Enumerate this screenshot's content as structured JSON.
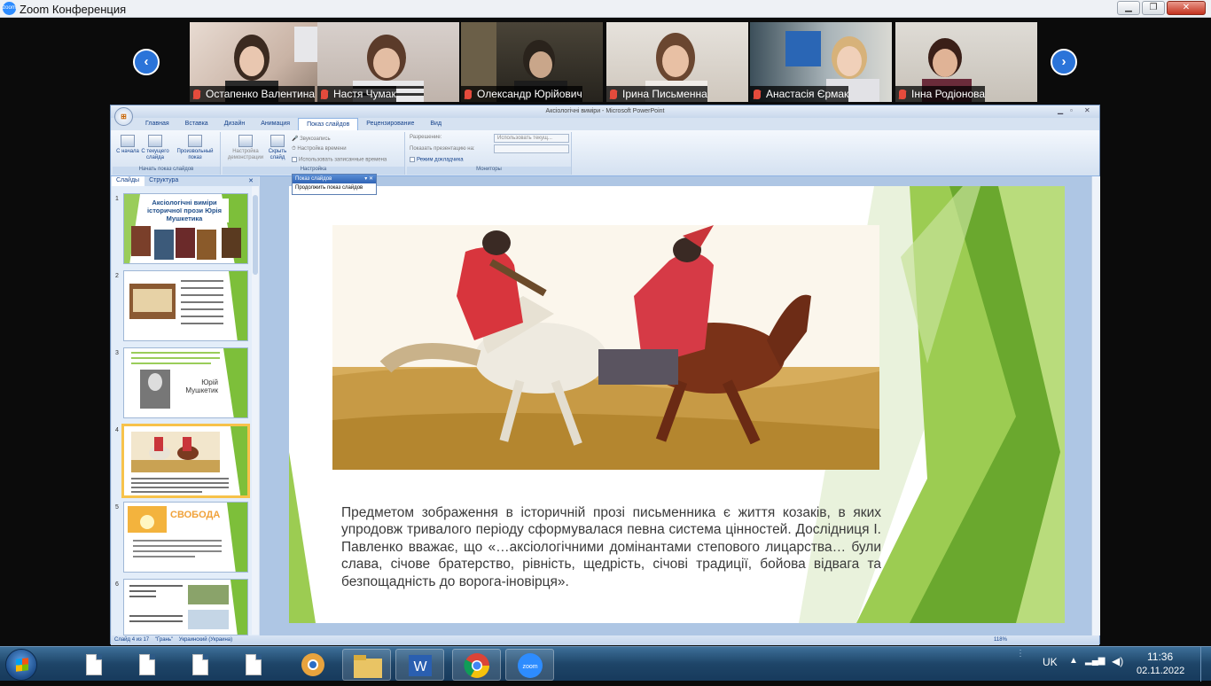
{
  "zoom_window": {
    "title": "Zoom Конференция",
    "icon_text": "zoom",
    "minimize": "▁",
    "maximize": "❐",
    "close": "✕"
  },
  "participants": [
    {
      "name": "Остапенко Валентина"
    },
    {
      "name": "Настя Чумак"
    },
    {
      "name": "Олександр Юрійович"
    },
    {
      "name": "Ірина Письменна"
    },
    {
      "name": "Анастасія Єрмак"
    },
    {
      "name": "Інна Родіонова"
    }
  ],
  "nav": {
    "prev": "‹",
    "next": "›"
  },
  "powerpoint": {
    "title": "Аксіологічні виміри - Microsoft PowerPoint",
    "tabs": [
      "Главная",
      "Вставка",
      "Дизайн",
      "Анимация",
      "Показ слайдов",
      "Рецензирование",
      "Вид"
    ],
    "active_tab": "Показ слайдов",
    "ribbon": {
      "group_start": {
        "from_start": "С начала",
        "from_current": "С текущего слайда",
        "custom": "Произвольный показ",
        "caption": "Начать показ слайдов"
      },
      "group_setup": {
        "setup": "Настройка демонстрации",
        "hide": "Скрыть слайд",
        "record_narration": "Звукозапись",
        "rehearse": "Настройка времени",
        "use_timings": "Использовать записанные времена",
        "caption": "Настройка"
      },
      "group_monitors": {
        "resolution_label": "Разрешение:",
        "resolution_value": "Использовать текущ...",
        "show_on_label": "Показать презентацию на:",
        "presenter_view": "Режим докладчика",
        "caption": "Мониторы"
      }
    },
    "popup": {
      "title": "Показ слайдов",
      "item": "Продолжить показ слайдов"
    },
    "side_tabs": [
      "Слайды",
      "Структура"
    ],
    "thumbnails": [
      {
        "num": "1",
        "title": "Аксіологічні виміри історичної прози Юрія Мушкетика"
      },
      {
        "num": "2",
        "text": "Історичний роман ... розкриття людської долі"
      },
      {
        "num": "3",
        "text": "Юрій Мушкетик"
      },
      {
        "num": "4",
        "text": ""
      },
      {
        "num": "5",
        "title": "СВОБОДА"
      },
      {
        "num": "6",
        "text": ""
      }
    ],
    "slide_text": "Предметом зображення в історичній прозі письменника є життя козаків, в яких упродовж тривалого періоду сформувалася певна система цінностей. Дослідниця І. Павленко вважає, що «…аксіологічними домінантами степового лицарства… були слава, січове братерство, рівність, щедрість, січові традиції, бойова відвага та безпощадність до ворога-іновірця».",
    "status": {
      "slide": "Слайд 4 из 17",
      "theme": "\"Грань\"",
      "language": "Украинский (Украина)",
      "zoom": "118%"
    }
  },
  "taskbar": {
    "language": "UK",
    "time": "11:36",
    "date": "02.11.2022",
    "word_letter": "W",
    "zoom_app": "zoom"
  },
  "colors": {
    "zoom_blue": "#2d8cff",
    "slide_green": "#7dbf3a",
    "taskbar": "#1e4568"
  }
}
